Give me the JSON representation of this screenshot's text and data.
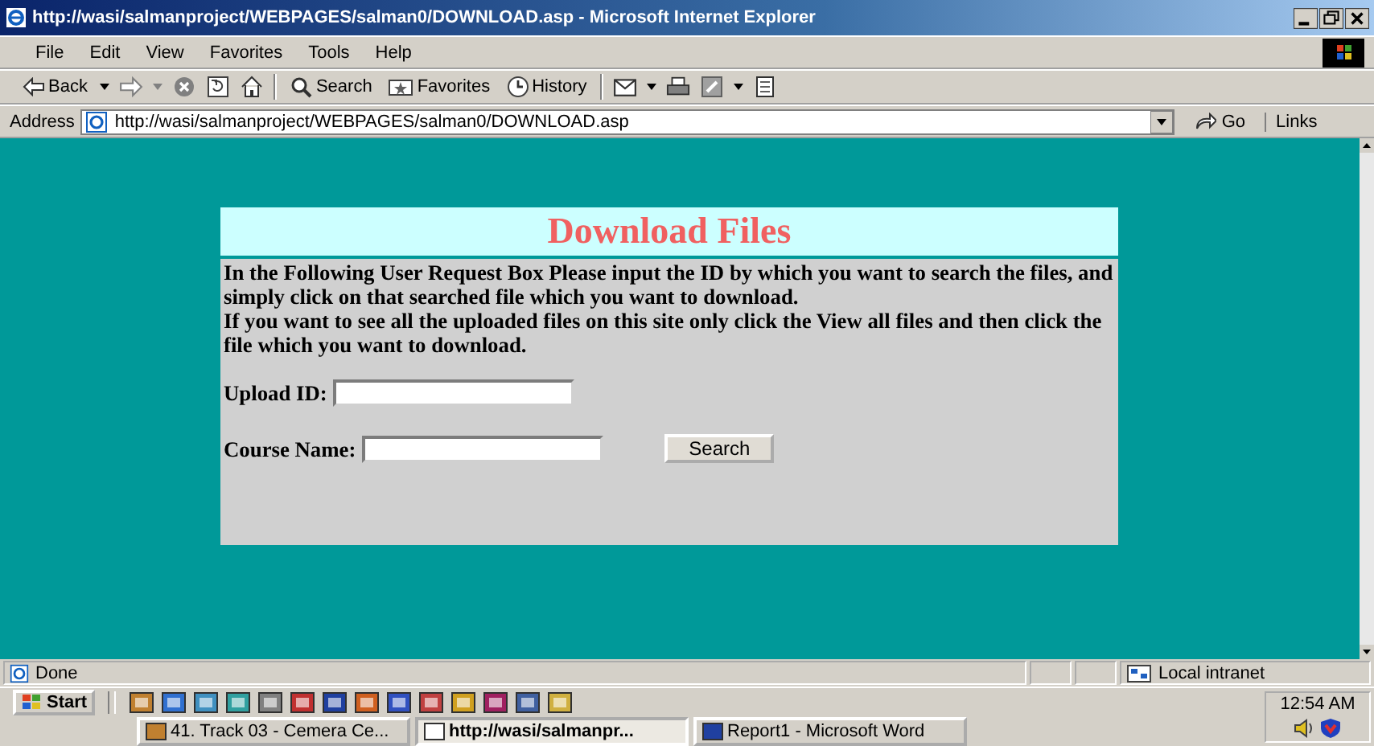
{
  "window": {
    "title": "http://wasi/salmanproject/WEBPAGES/salman0/DOWNLOAD.asp - Microsoft Internet Explorer"
  },
  "menu": [
    "File",
    "Edit",
    "View",
    "Favorites",
    "Tools",
    "Help"
  ],
  "toolbar": [
    {
      "kind": "back",
      "label": "Back"
    },
    {
      "kind": "forward"
    },
    {
      "kind": "stop"
    },
    {
      "kind": "refresh"
    },
    {
      "kind": "home"
    },
    {
      "kind": "search",
      "label": "Search"
    },
    {
      "kind": "favorites",
      "label": "Favorites"
    },
    {
      "kind": "history",
      "label": "History"
    },
    {
      "kind": "mail"
    },
    {
      "kind": "print"
    },
    {
      "kind": "edit"
    },
    {
      "kind": "discuss"
    }
  ],
  "address_bar": {
    "label": "Address",
    "url": "http://wasi/salmanproject/WEBPAGES/salman0/DOWNLOAD.asp",
    "go": "Go",
    "links": "Links"
  },
  "page": {
    "heading": "Download Files",
    "paragraphs": [
      "In the Following User Request Box Please input the ID by which you want to search the files, and simply click on that searched file which you want to download.",
      "If you want to see all the uploaded files on this site only click the View all files and then click the file which you want to download."
    ],
    "fields": [
      {
        "label": "Upload ID:"
      },
      {
        "label": "Course Name:"
      }
    ],
    "search_button": "Search"
  },
  "status_bar": {
    "text": "Done",
    "zone": "Local intranet"
  },
  "taskbar": {
    "start": "Start",
    "clock": "12:54 AM",
    "tasks": [
      {
        "label": "41. Track 03 - Cemera Ce...",
        "selected": false
      },
      {
        "label": "http://wasi/salmanpr...",
        "selected": true
      },
      {
        "label": "Report1 - Microsoft Word",
        "selected": false
      }
    ]
  }
}
